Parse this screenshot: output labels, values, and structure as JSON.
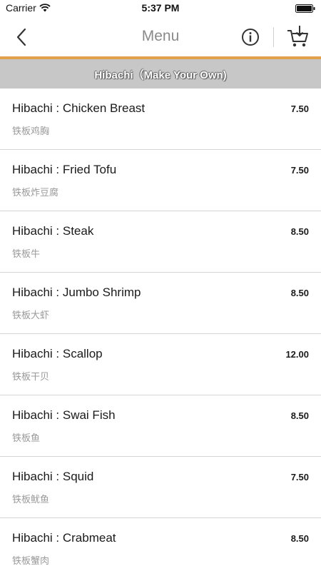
{
  "status": {
    "carrier": "Carrier",
    "time": "5:37 PM"
  },
  "nav": {
    "title": "Menu"
  },
  "category": {
    "title": "Hibachi（Make Your Own)"
  },
  "items": [
    {
      "name": "Hibachi : Chicken Breast",
      "sub": "铁板鸡胸",
      "price": "7.50"
    },
    {
      "name": "Hibachi : Fried Tofu",
      "sub": "铁板炸豆腐",
      "price": "7.50"
    },
    {
      "name": "Hibachi : Steak",
      "sub": "铁板牛",
      "price": "8.50"
    },
    {
      "name": "Hibachi : Jumbo Shrimp",
      "sub": "铁板大虾",
      "price": "8.50"
    },
    {
      "name": "Hibachi : Scallop",
      "sub": "铁板干贝",
      "price": "12.00"
    },
    {
      "name": "Hibachi : Swai Fish",
      "sub": "铁板鱼",
      "price": "8.50"
    },
    {
      "name": "Hibachi : Squid",
      "sub": "铁板鱿鱼",
      "price": "7.50"
    },
    {
      "name": "Hibachi : Crabmeat",
      "sub": "铁板蟹肉",
      "price": "8.50"
    }
  ],
  "colors": {
    "accent": "#e3a04a",
    "header_bg": "#c7c7c7",
    "title": "#8a8a8a"
  },
  "icons": [
    "wifi-icon",
    "battery-icon",
    "back-chevron-icon",
    "info-icon",
    "cart-icon"
  ]
}
